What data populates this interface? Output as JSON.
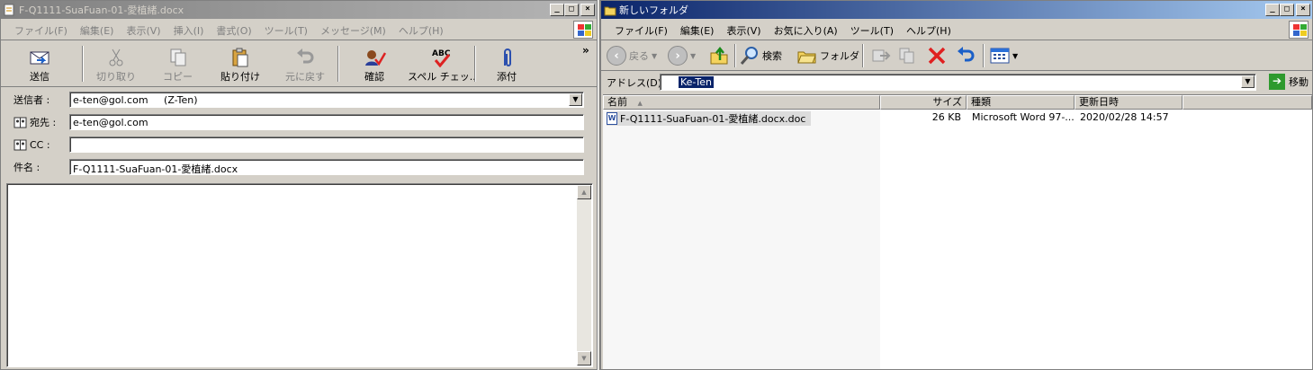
{
  "left_window": {
    "title": "F-Q1111-SuaFuan-01-愛植緒.docx",
    "menu": [
      "ファイル(F)",
      "編集(E)",
      "表示(V)",
      "挿入(I)",
      "書式(O)",
      "ツール(T)",
      "メッセージ(M)",
      "ヘルプ(H)"
    ],
    "toolbar": {
      "send": "送信",
      "cut": "切り取り",
      "copy": "コピー",
      "paste": "貼り付け",
      "undo": "元に戻す",
      "check": "確認",
      "spell": "スペル チェッ..",
      "attach": "添付",
      "more": "»"
    },
    "fields": {
      "from_label": "送信者 :",
      "from_value": "e-ten@gol.com     (Z-Ten)",
      "to_label": "宛先 :",
      "to_value": "e-ten@gol.com",
      "cc_label": "CC :",
      "cc_value": "",
      "subject_label": "件名 :",
      "subject_value": "F-Q1111-SuaFuan-01-愛植緒.docx"
    },
    "body": ""
  },
  "right_window": {
    "title": "新しいフォルダ",
    "menu": [
      "ファイル(F)",
      "編集(E)",
      "表示(V)",
      "お気に入り(A)",
      "ツール(T)",
      "ヘルプ(H)"
    ],
    "toolbar": {
      "back": "戻る",
      "search": "検索",
      "folders": "フォルダ"
    },
    "address": {
      "label": "アドレス(D)",
      "value": "Ke-Ten",
      "go": "移動"
    },
    "columns": {
      "name": "名前",
      "size": "サイズ",
      "type": "種類",
      "modified": "更新日時"
    },
    "files": [
      {
        "name": "F-Q1111-SuaFuan-01-愛植緒.docx.doc",
        "size": "26 KB",
        "type": "Microsoft Word 97-...",
        "modified": "2020/02/28 14:57"
      }
    ]
  },
  "colors": {
    "active_title": "#0a246a",
    "inactive_title": "#808080",
    "face": "#d4d0c8",
    "selection": "#0a246a"
  }
}
